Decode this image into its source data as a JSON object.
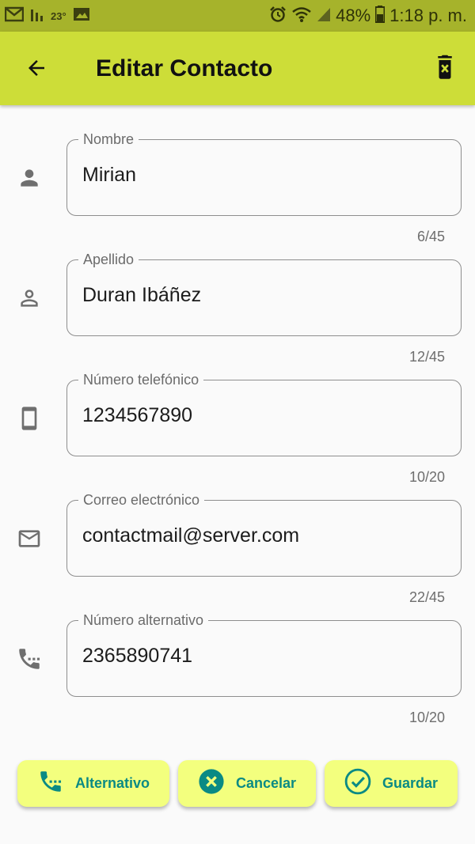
{
  "status_bar": {
    "temperature": "23°",
    "battery_percent": "48%",
    "time": "1:18 p. m.",
    "icons": [
      "gmail-icon",
      "signal-bars-icon",
      "image-icon",
      "alarm-icon",
      "wifi-icon",
      "cell-signal-icon",
      "battery-icon"
    ]
  },
  "app_bar": {
    "title": "Editar Contacto",
    "back_icon": "arrow-back-icon",
    "delete_icon": "delete-icon",
    "background_color": "#cddd38"
  },
  "fields": [
    {
      "label": "Nombre",
      "value": "Mirian",
      "counter": "6/45",
      "icon": "person-icon"
    },
    {
      "label": "Apellido",
      "value": "Duran Ibáñez",
      "counter": "12/45",
      "icon": "person-outline-icon"
    },
    {
      "label": "Número telefónico",
      "value": "1234567890",
      "counter": "10/20",
      "icon": "smartphone-icon"
    },
    {
      "label": "Correo electrónico",
      "value": "contactmail@server.com",
      "counter": "22/45",
      "icon": "mail-outline-icon"
    },
    {
      "label": "Número alternativo",
      "value": "2365890741",
      "counter": "10/20",
      "icon": "dialpad-phone-icon"
    }
  ],
  "buttons": {
    "alternativo": "Alternativo",
    "cancelar": "Cancelar",
    "guardar": "Guardar"
  },
  "colors": {
    "accent": "#0a8a84",
    "button_bg": "#f3ff7e",
    "status_bar": "#a6b32b"
  }
}
